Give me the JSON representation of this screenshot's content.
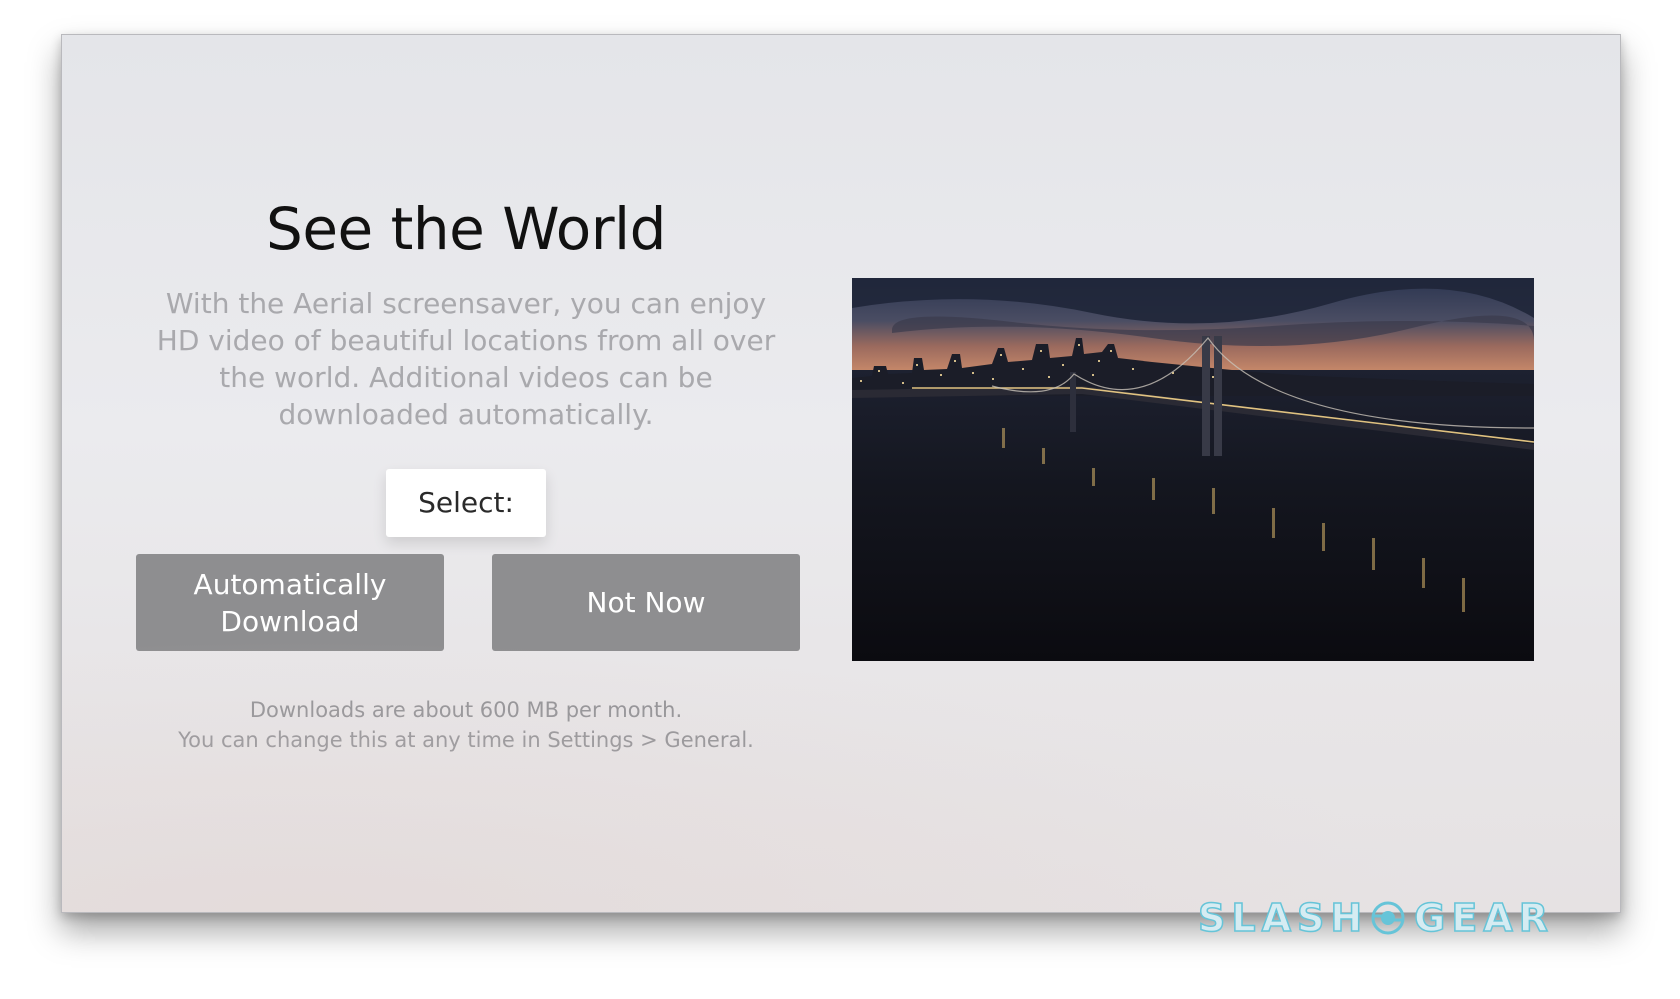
{
  "screen": {
    "title": "See the World",
    "description": "With the Aerial screensaver, you can enjoy HD video of beautiful locations from all over the world. Additional videos can be downloaded automatically.",
    "select_label": "Select:",
    "buttons": {
      "auto_download_line1": "Automatically",
      "auto_download_line2": "Download",
      "not_now": "Not Now"
    },
    "footnote": {
      "line1": "Downloads are about 600 MB per month.",
      "line2": "You can change this at any time in Settings > General."
    }
  },
  "watermark": {
    "left": "SLASH",
    "right": "GEAR"
  },
  "colors": {
    "button_bg": "#8e8e90",
    "title_text": "#111111",
    "body_text": "#a9a9ad",
    "watermark": "#66c4d8"
  }
}
